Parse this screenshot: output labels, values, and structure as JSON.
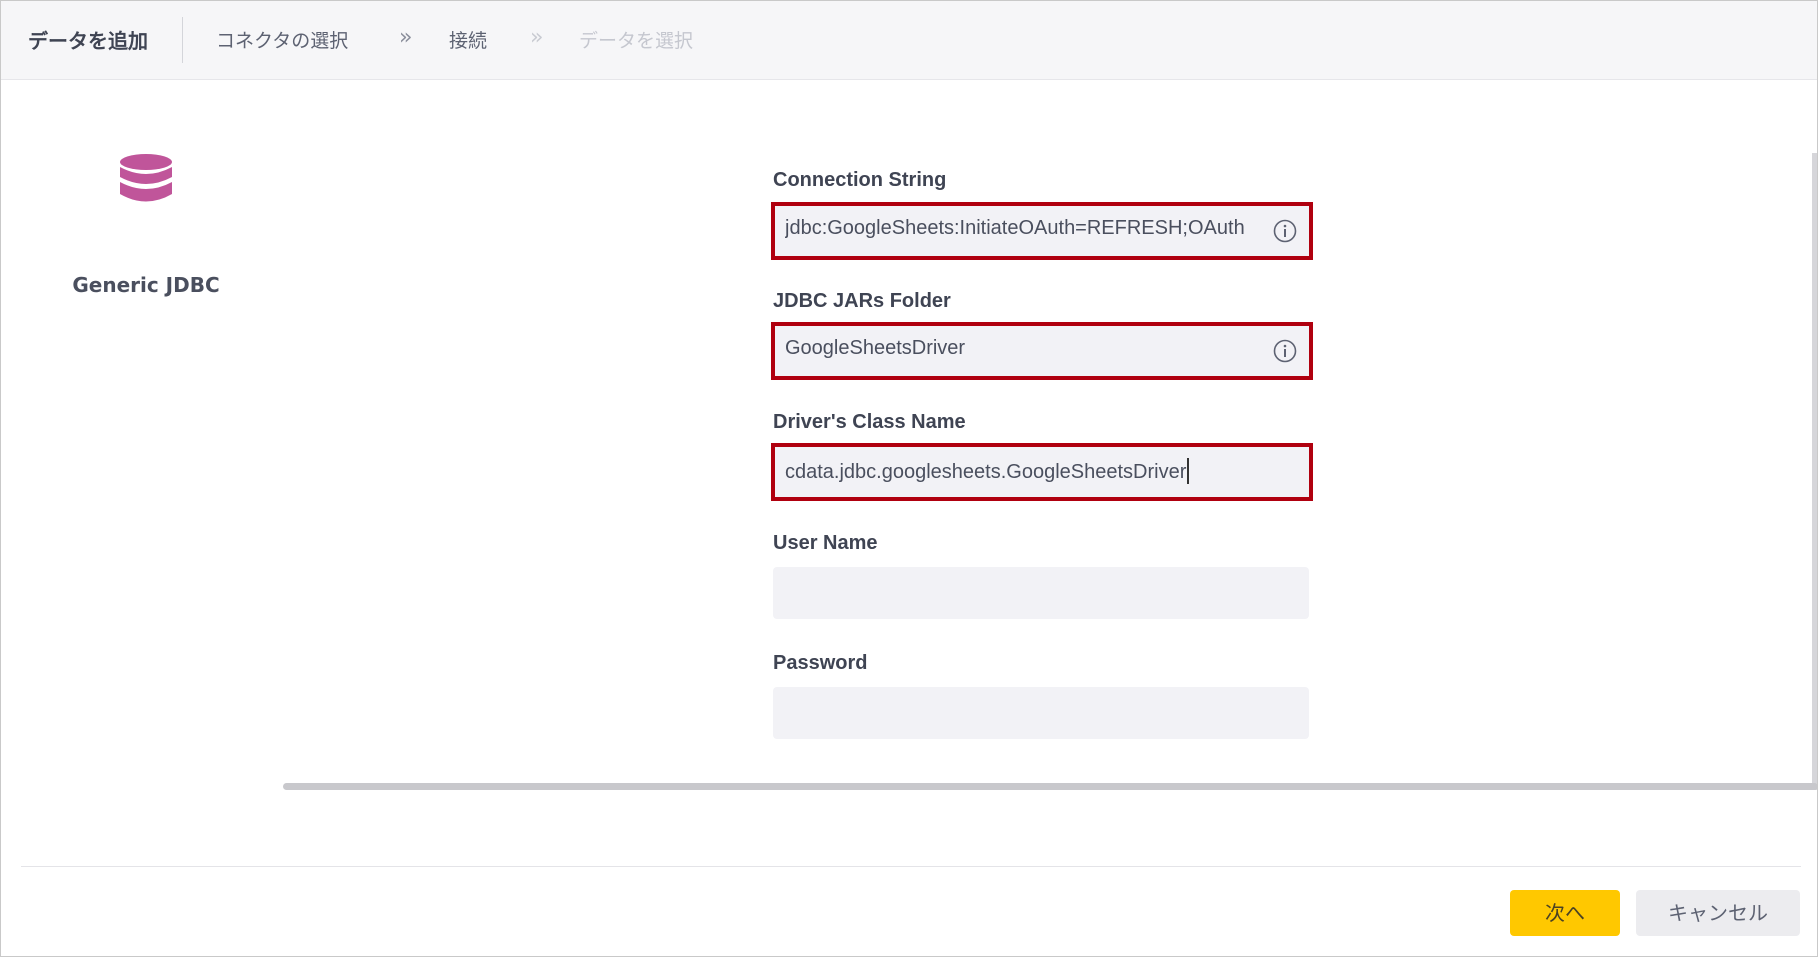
{
  "header": {
    "title": "データを追加",
    "breadcrumb": [
      {
        "label": "コネクタの選択",
        "state": "done"
      },
      {
        "label": "接続",
        "state": "active"
      },
      {
        "label": "データを選択",
        "state": "disabled"
      }
    ],
    "separator": "»"
  },
  "connector": {
    "icon": "database-icon",
    "name": "Generic JDBC",
    "icon_color": "#c0559a"
  },
  "form": {
    "connection_string": {
      "label": "Connection String",
      "value": "jdbc:GoogleSheets:InitiateOAuth=REFRESH;OAuth",
      "info_icon": "info-icon"
    },
    "jdbc_jars_folder": {
      "label": "JDBC JARs Folder",
      "value": "GoogleSheetsDriver",
      "info_icon": "info-icon"
    },
    "driver_class_name": {
      "label": "Driver's Class Name",
      "value": "cdata.jdbc.googlesheets.GoogleSheetsDriver"
    },
    "user_name": {
      "label": "User Name",
      "value": ""
    },
    "password": {
      "label": "Password",
      "value": ""
    }
  },
  "footer": {
    "next_label": "次へ",
    "cancel_label": "キャンセル"
  },
  "colors": {
    "highlight_border": "#b0000f",
    "primary_button": "#ffc800",
    "input_bg": "#f2f2f6"
  }
}
